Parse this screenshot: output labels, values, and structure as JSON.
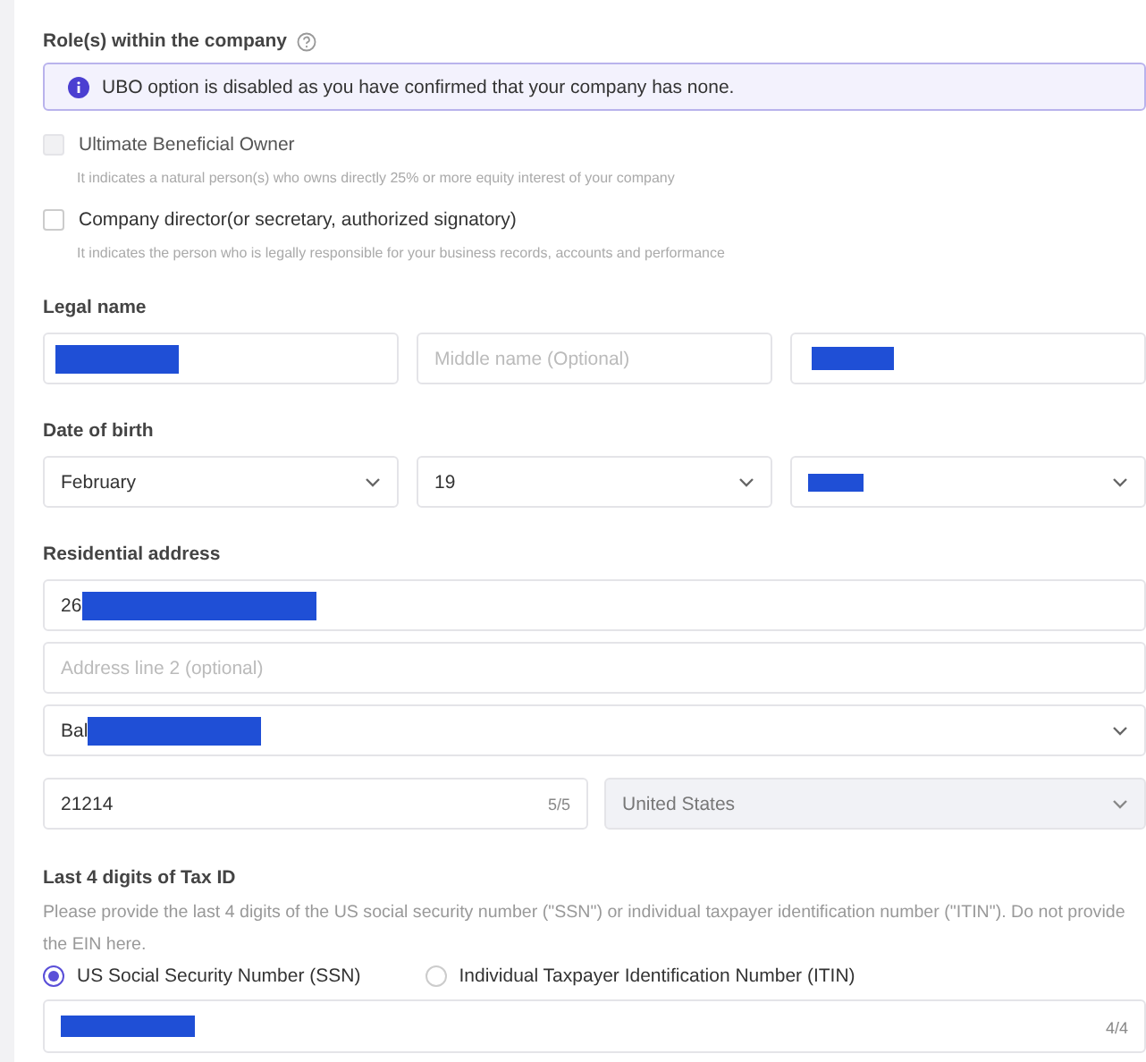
{
  "roles": {
    "title": "Role(s) within the company",
    "notice": "UBO option is disabled as you have confirmed that your company has none.",
    "options": [
      {
        "label": "Ultimate Beneficial Owner",
        "hint": "It indicates a natural person(s) who owns directly 25% or more equity interest of your company",
        "checked": false,
        "disabled": true
      },
      {
        "label": "Company director(or secretary, authorized signatory)",
        "hint": "It indicates the person who is legally responsible for your business records, accounts and performance",
        "checked": false,
        "disabled": false
      }
    ]
  },
  "legal_name": {
    "label": "Legal name",
    "fields": [
      {
        "redacted": true
      },
      {
        "placeholder": "Middle name (Optional)",
        "redacted": false
      },
      {
        "redacted": true
      }
    ]
  },
  "date_of_birth": {
    "label": "Date of birth",
    "fields": [
      {
        "value": "February",
        "redacted": false
      },
      {
        "value": "19",
        "redacted": false
      },
      {
        "redacted": true
      }
    ]
  },
  "address": {
    "label": "Residential address",
    "line1": {
      "value": "26",
      "redacted": true
    },
    "line2": {
      "placeholder": "Address line 2 (optional)"
    },
    "city": {
      "value": "Bal",
      "redacted": true
    },
    "zip": {
      "value": "21214",
      "counter": "5/5"
    },
    "country": {
      "value": "United States",
      "disabled": true
    }
  },
  "tax_id": {
    "label": "Last 4 digits of Tax ID",
    "description": "Please provide the last 4 digits of the US social security number (\"SSN\") or individual taxpayer identification number (\"ITIN\"). Do not provide the EIN here.",
    "types": [
      {
        "label": "US Social Security Number (SSN)",
        "selected": true
      },
      {
        "label": "Individual Taxpayer Identification Number (ITIN)",
        "selected": false
      }
    ],
    "field": {
      "redacted": true,
      "counter": "4/4"
    }
  }
}
